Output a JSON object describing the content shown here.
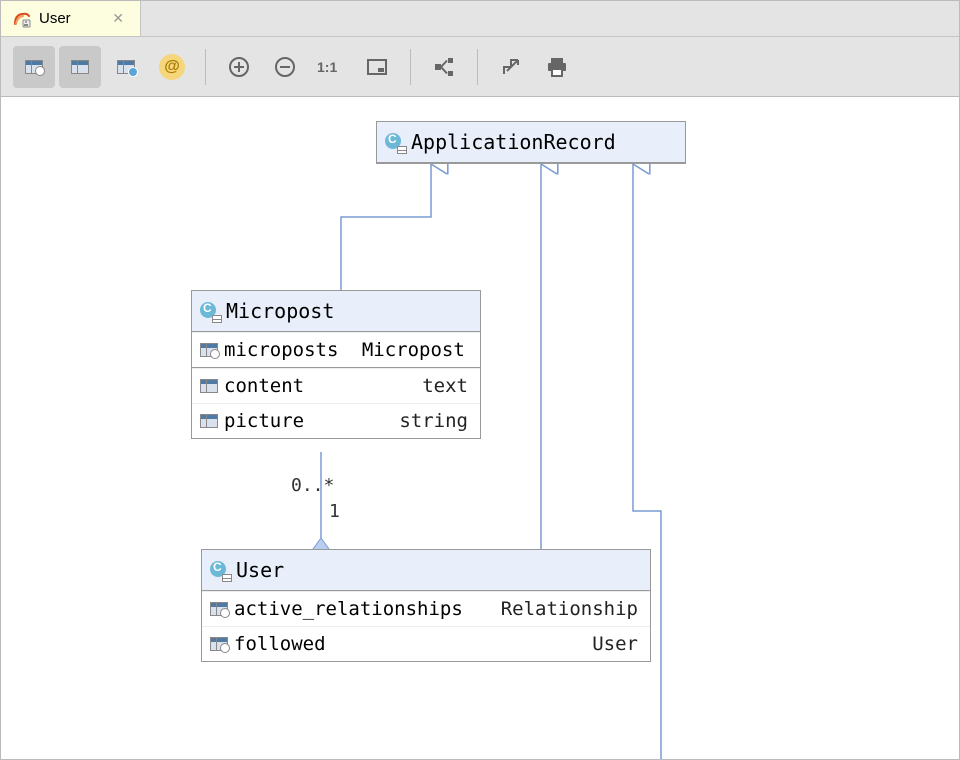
{
  "tab": {
    "label": "User"
  },
  "toolbar": {},
  "diagram": {
    "application_record": {
      "name": "ApplicationRecord"
    },
    "micropost": {
      "name": "Micropost",
      "assoc": {
        "label": "microposts",
        "type": "Micropost"
      },
      "cols": [
        {
          "label": "content",
          "type": "text"
        },
        {
          "label": "picture",
          "type": "string"
        }
      ]
    },
    "user": {
      "name": "User",
      "assocs": [
        {
          "label": "active_relationships",
          "type": "Relationship"
        },
        {
          "label": "followed",
          "type": "User"
        }
      ]
    },
    "cardinality": {
      "top": "0..*",
      "bottom": "1"
    }
  }
}
